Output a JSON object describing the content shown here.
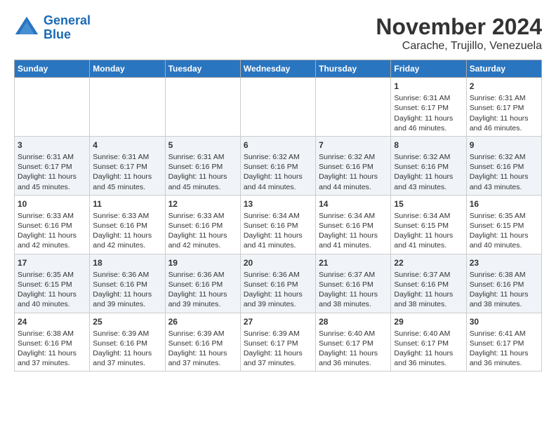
{
  "header": {
    "logo_line1": "General",
    "logo_line2": "Blue",
    "title": "November 2024",
    "subtitle": "Carache, Trujillo, Venezuela"
  },
  "calendar": {
    "weekdays": [
      "Sunday",
      "Monday",
      "Tuesday",
      "Wednesday",
      "Thursday",
      "Friday",
      "Saturday"
    ],
    "weeks": [
      [
        {
          "day": "",
          "info": ""
        },
        {
          "day": "",
          "info": ""
        },
        {
          "day": "",
          "info": ""
        },
        {
          "day": "",
          "info": ""
        },
        {
          "day": "",
          "info": ""
        },
        {
          "day": "1",
          "info": "Sunrise: 6:31 AM\nSunset: 6:17 PM\nDaylight: 11 hours and 46 minutes."
        },
        {
          "day": "2",
          "info": "Sunrise: 6:31 AM\nSunset: 6:17 PM\nDaylight: 11 hours and 46 minutes."
        }
      ],
      [
        {
          "day": "3",
          "info": "Sunrise: 6:31 AM\nSunset: 6:17 PM\nDaylight: 11 hours and 45 minutes."
        },
        {
          "day": "4",
          "info": "Sunrise: 6:31 AM\nSunset: 6:17 PM\nDaylight: 11 hours and 45 minutes."
        },
        {
          "day": "5",
          "info": "Sunrise: 6:31 AM\nSunset: 6:16 PM\nDaylight: 11 hours and 45 minutes."
        },
        {
          "day": "6",
          "info": "Sunrise: 6:32 AM\nSunset: 6:16 PM\nDaylight: 11 hours and 44 minutes."
        },
        {
          "day": "7",
          "info": "Sunrise: 6:32 AM\nSunset: 6:16 PM\nDaylight: 11 hours and 44 minutes."
        },
        {
          "day": "8",
          "info": "Sunrise: 6:32 AM\nSunset: 6:16 PM\nDaylight: 11 hours and 43 minutes."
        },
        {
          "day": "9",
          "info": "Sunrise: 6:32 AM\nSunset: 6:16 PM\nDaylight: 11 hours and 43 minutes."
        }
      ],
      [
        {
          "day": "10",
          "info": "Sunrise: 6:33 AM\nSunset: 6:16 PM\nDaylight: 11 hours and 42 minutes."
        },
        {
          "day": "11",
          "info": "Sunrise: 6:33 AM\nSunset: 6:16 PM\nDaylight: 11 hours and 42 minutes."
        },
        {
          "day": "12",
          "info": "Sunrise: 6:33 AM\nSunset: 6:16 PM\nDaylight: 11 hours and 42 minutes."
        },
        {
          "day": "13",
          "info": "Sunrise: 6:34 AM\nSunset: 6:16 PM\nDaylight: 11 hours and 41 minutes."
        },
        {
          "day": "14",
          "info": "Sunrise: 6:34 AM\nSunset: 6:16 PM\nDaylight: 11 hours and 41 minutes."
        },
        {
          "day": "15",
          "info": "Sunrise: 6:34 AM\nSunset: 6:15 PM\nDaylight: 11 hours and 41 minutes."
        },
        {
          "day": "16",
          "info": "Sunrise: 6:35 AM\nSunset: 6:15 PM\nDaylight: 11 hours and 40 minutes."
        }
      ],
      [
        {
          "day": "17",
          "info": "Sunrise: 6:35 AM\nSunset: 6:15 PM\nDaylight: 11 hours and 40 minutes."
        },
        {
          "day": "18",
          "info": "Sunrise: 6:36 AM\nSunset: 6:16 PM\nDaylight: 11 hours and 39 minutes."
        },
        {
          "day": "19",
          "info": "Sunrise: 6:36 AM\nSunset: 6:16 PM\nDaylight: 11 hours and 39 minutes."
        },
        {
          "day": "20",
          "info": "Sunrise: 6:36 AM\nSunset: 6:16 PM\nDaylight: 11 hours and 39 minutes."
        },
        {
          "day": "21",
          "info": "Sunrise: 6:37 AM\nSunset: 6:16 PM\nDaylight: 11 hours and 38 minutes."
        },
        {
          "day": "22",
          "info": "Sunrise: 6:37 AM\nSunset: 6:16 PM\nDaylight: 11 hours and 38 minutes."
        },
        {
          "day": "23",
          "info": "Sunrise: 6:38 AM\nSunset: 6:16 PM\nDaylight: 11 hours and 38 minutes."
        }
      ],
      [
        {
          "day": "24",
          "info": "Sunrise: 6:38 AM\nSunset: 6:16 PM\nDaylight: 11 hours and 37 minutes."
        },
        {
          "day": "25",
          "info": "Sunrise: 6:39 AM\nSunset: 6:16 PM\nDaylight: 11 hours and 37 minutes."
        },
        {
          "day": "26",
          "info": "Sunrise: 6:39 AM\nSunset: 6:16 PM\nDaylight: 11 hours and 37 minutes."
        },
        {
          "day": "27",
          "info": "Sunrise: 6:39 AM\nSunset: 6:17 PM\nDaylight: 11 hours and 37 minutes."
        },
        {
          "day": "28",
          "info": "Sunrise: 6:40 AM\nSunset: 6:17 PM\nDaylight: 11 hours and 36 minutes."
        },
        {
          "day": "29",
          "info": "Sunrise: 6:40 AM\nSunset: 6:17 PM\nDaylight: 11 hours and 36 minutes."
        },
        {
          "day": "30",
          "info": "Sunrise: 6:41 AM\nSunset: 6:17 PM\nDaylight: 11 hours and 36 minutes."
        }
      ]
    ]
  }
}
